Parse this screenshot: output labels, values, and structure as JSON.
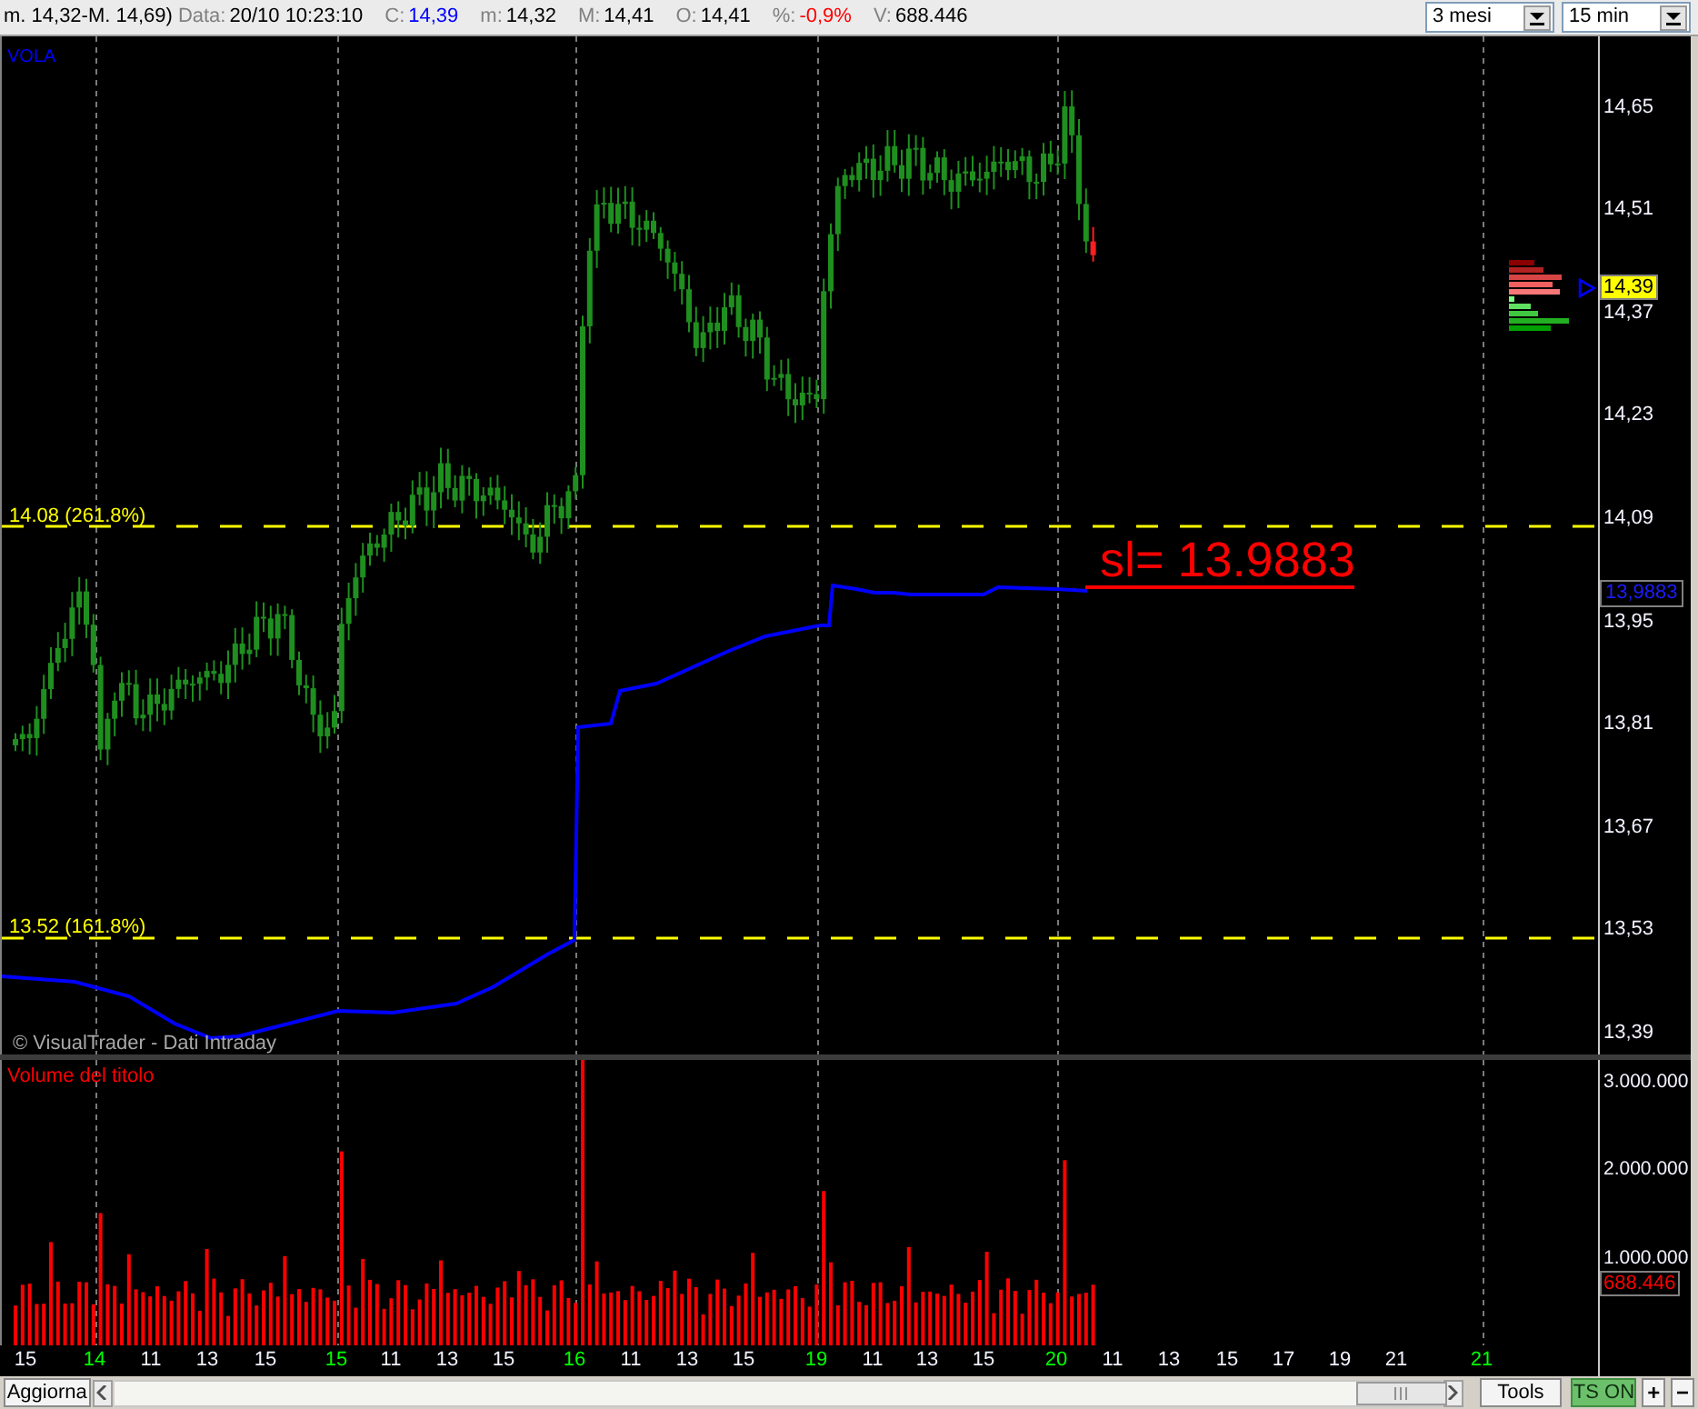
{
  "info_bar": {
    "range": "m. 14,32-M. 14,69)",
    "fields": [
      {
        "label": "Data:",
        "value": "20/10 10:23:10",
        "color": "#000000"
      },
      {
        "label": "C:",
        "value": "14,39",
        "color": "#0000ff"
      },
      {
        "label": "m:",
        "value": "14,32",
        "color": "#000000"
      },
      {
        "label": "M:",
        "value": "14,41",
        "color": "#000000"
      },
      {
        "label": "O:",
        "value": "14,41",
        "color": "#000000"
      },
      {
        "label": "%:",
        "value": "-0,9%",
        "color": "#ff0000"
      },
      {
        "label": "V:",
        "value": "688.446",
        "color": "#000000"
      }
    ],
    "dropdowns": [
      {
        "value": "3 mesi"
      },
      {
        "value": "15 min"
      }
    ]
  },
  "price_panel": {
    "title": "VOLA",
    "y_axis": [
      "14,65",
      "14,51",
      "14,37",
      "14,23",
      "14,09",
      "13,95",
      "13,81",
      "13,67",
      "13,53",
      "13,39"
    ],
    "levels": [
      {
        "label": "14.08 (261.8%)"
      },
      {
        "label": "13.52 (161.8%)"
      }
    ],
    "stop_loss_annotation": "sl= 13.9883",
    "last_price_tag": "14,39",
    "stop_loss_tag": "13,9883",
    "copyright": "© VisualTrader - Dati Intraday"
  },
  "volume_panel": {
    "title": "Volume del titolo",
    "y_axis": [
      "3.000.000",
      "2.000.000",
      "1.000.000"
    ],
    "last_volume_tag": "688.446"
  },
  "time_axis": [
    {
      "label": "15",
      "new_day": false
    },
    {
      "label": "14",
      "new_day": true
    },
    {
      "label": "11",
      "new_day": false
    },
    {
      "label": "13",
      "new_day": false
    },
    {
      "label": "15",
      "new_day": false
    },
    {
      "label": "15",
      "new_day": true
    },
    {
      "label": "11",
      "new_day": false
    },
    {
      "label": "13",
      "new_day": false
    },
    {
      "label": "15",
      "new_day": false
    },
    {
      "label": "16",
      "new_day": true
    },
    {
      "label": "11",
      "new_day": false
    },
    {
      "label": "13",
      "new_day": false
    },
    {
      "label": "15",
      "new_day": false
    },
    {
      "label": "19",
      "new_day": true
    },
    {
      "label": "11",
      "new_day": false
    },
    {
      "label": "13",
      "new_day": false
    },
    {
      "label": "15",
      "new_day": false
    },
    {
      "label": "20",
      "new_day": true
    },
    {
      "label": "11",
      "new_day": false
    },
    {
      "label": "13",
      "new_day": false
    },
    {
      "label": "15",
      "new_day": false
    },
    {
      "label": "17",
      "new_day": false
    },
    {
      "label": "19",
      "new_day": false
    },
    {
      "label": "21",
      "new_day": false
    },
    {
      "label": "21",
      "new_day": true
    }
  ],
  "bottom_bar": {
    "refresh_button": "Aggiorna",
    "tools_button": "Tools",
    "ts_button": {
      "label": "TS ON",
      "on": true
    },
    "zoom_buttons": [
      "+",
      "−"
    ]
  }
}
